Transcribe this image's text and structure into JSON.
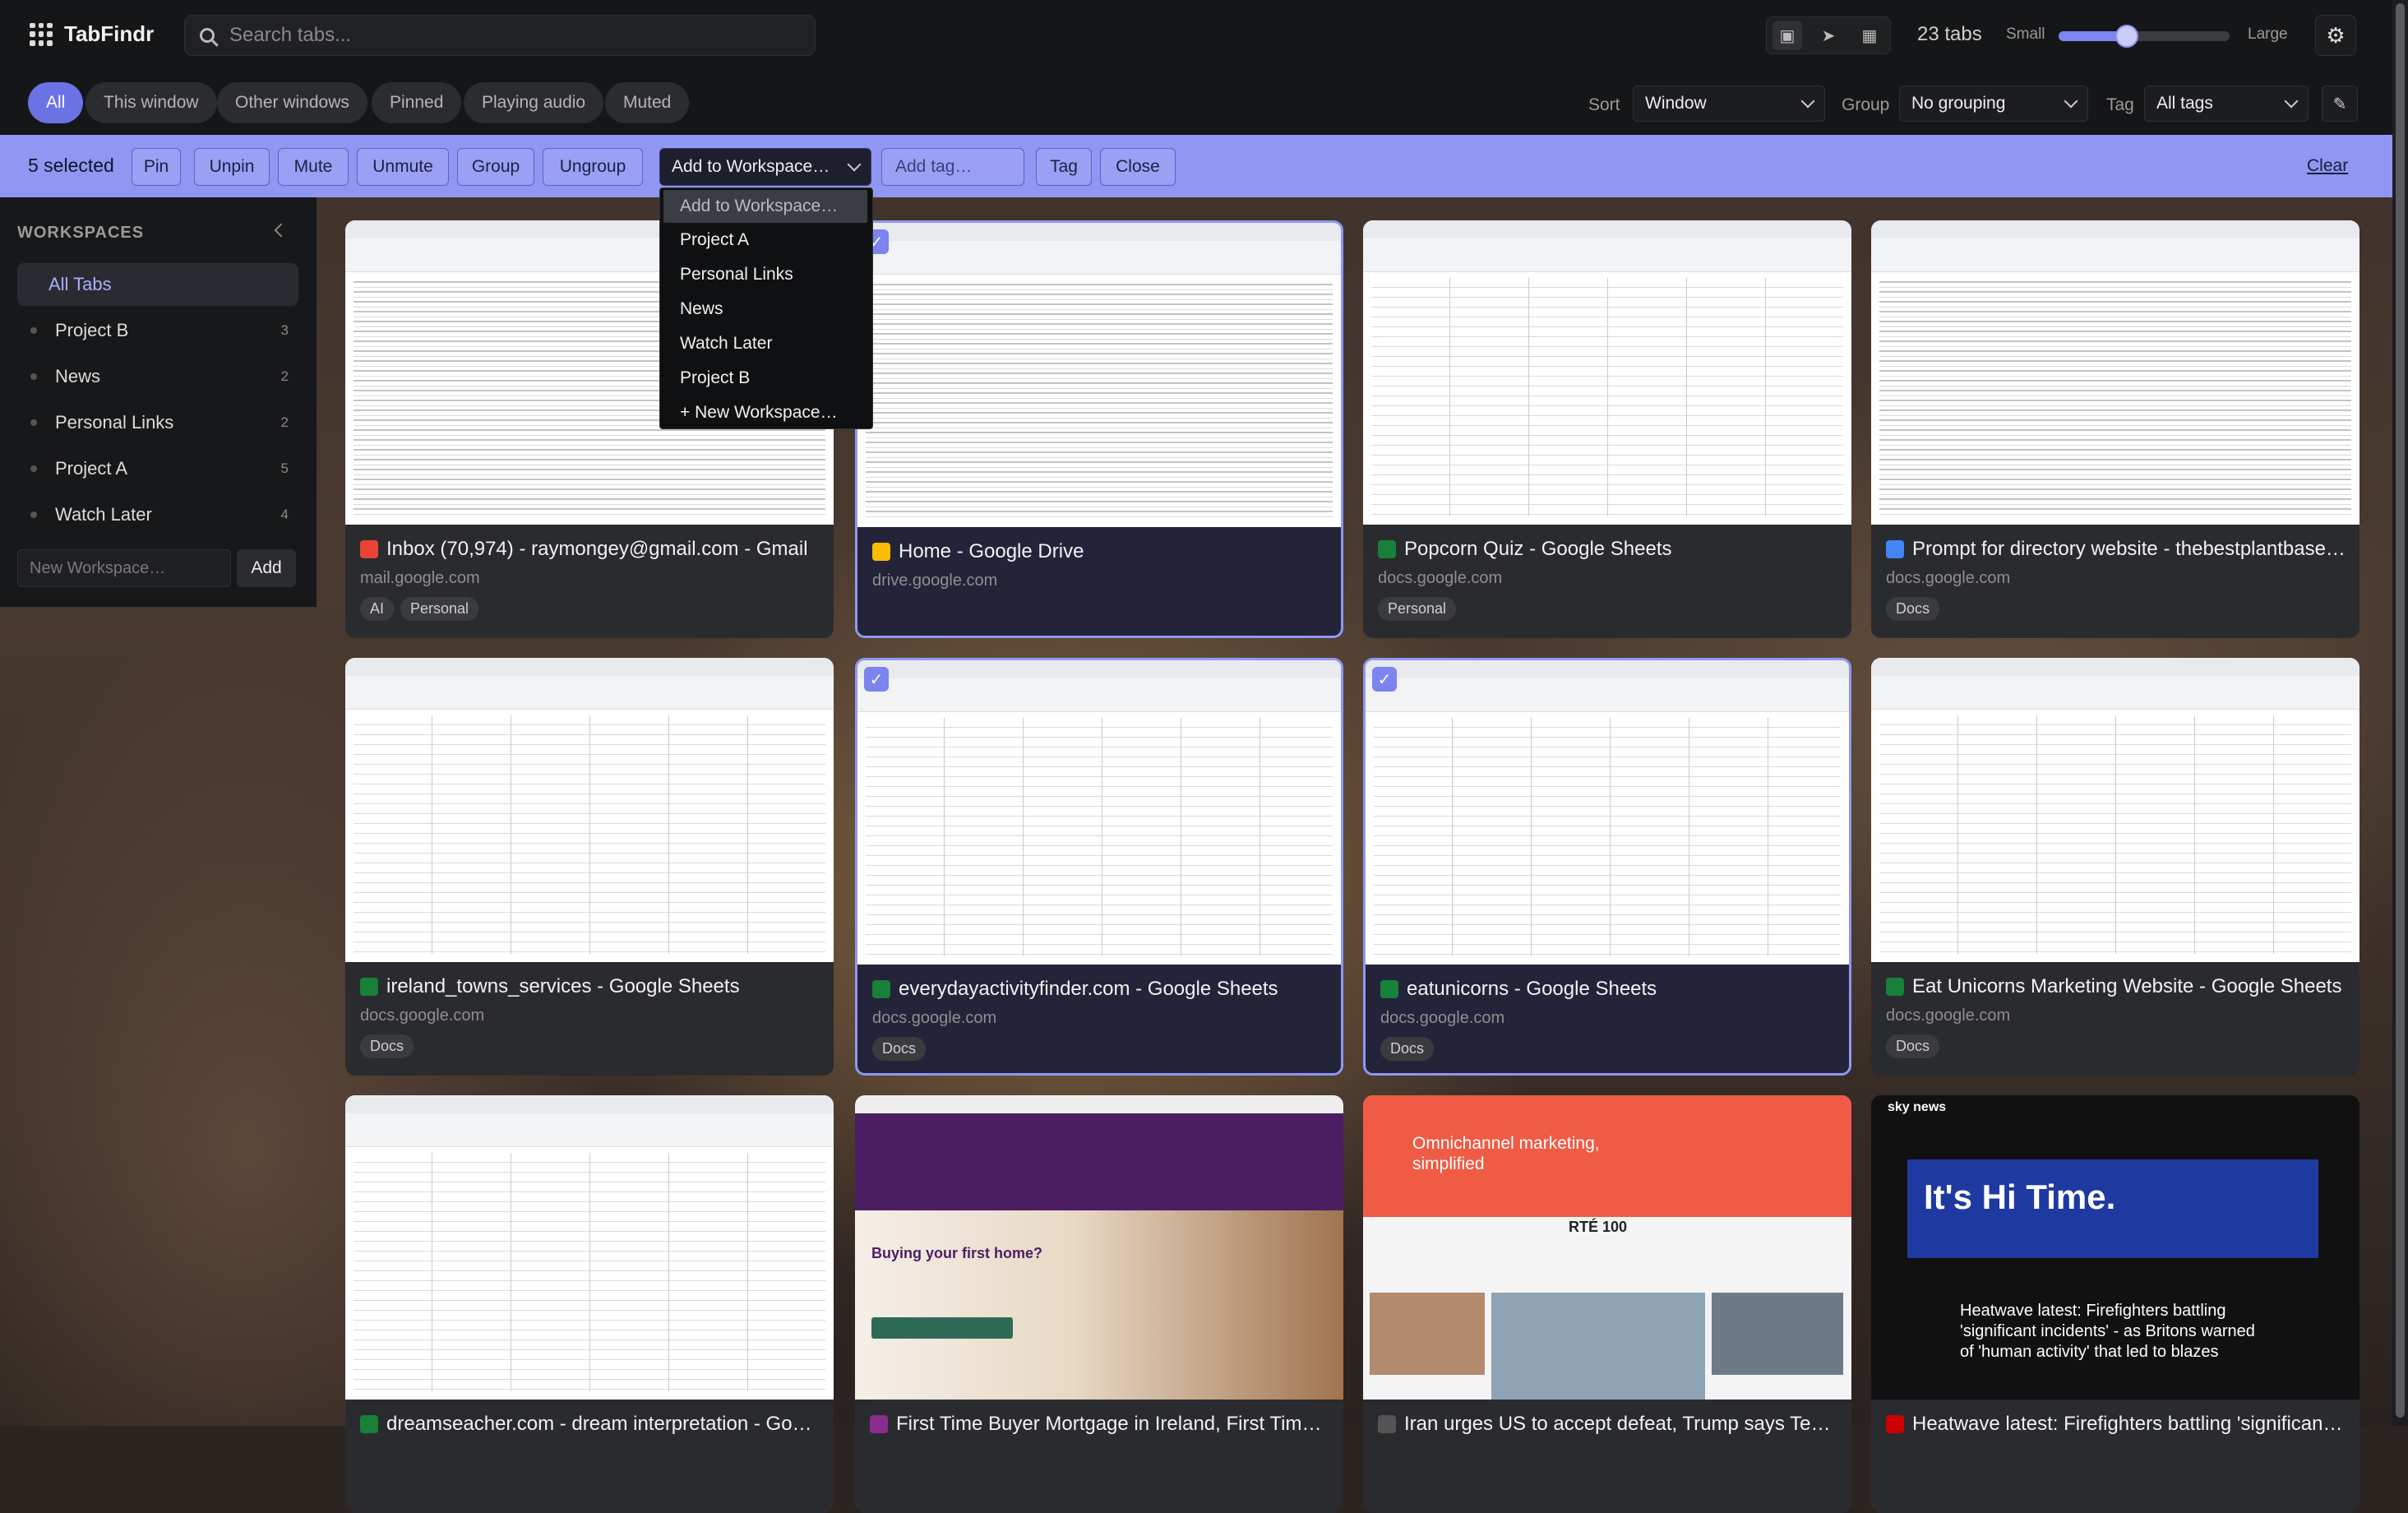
{
  "app": {
    "name": "TabFindr"
  },
  "search": {
    "placeholder": "Search tabs..."
  },
  "header": {
    "tab_count": "23 tabs",
    "size_small": "Small",
    "size_large": "Large",
    "size_value": 0.4
  },
  "filters": {
    "chips": [
      "All",
      "This window",
      "Other windows",
      "Pinned",
      "Playing audio",
      "Muted"
    ],
    "active": "All",
    "sort_label": "Sort",
    "sort_value": "Window",
    "group_label": "Group",
    "group_value": "No grouping",
    "tag_label": "Tag",
    "tag_value": "All tags"
  },
  "selection": {
    "count": "5 selected",
    "buttons": {
      "pin": "Pin",
      "unpin": "Unpin",
      "mute": "Mute",
      "unmute": "Unmute",
      "group": "Group",
      "ungroup": "Ungroup",
      "tag": "Tag",
      "close": "Close"
    },
    "workspace_select": "Add to Workspace…",
    "tag_placeholder": "Add tag…",
    "clear": "Clear"
  },
  "dropdown": {
    "items": [
      "Add to Workspace…",
      "Project A",
      "Personal Links",
      "News",
      "Watch Later",
      "Project B",
      "+ New Workspace…"
    ]
  },
  "sidebar": {
    "title": "WORKSPACES",
    "items": [
      {
        "label": "All Tabs",
        "count": ""
      },
      {
        "label": "Project B",
        "count": "3"
      },
      {
        "label": "News",
        "count": "2"
      },
      {
        "label": "Personal Links",
        "count": "2"
      },
      {
        "label": "Project A",
        "count": "5"
      },
      {
        "label": "Watch Later",
        "count": "4"
      }
    ],
    "new_placeholder": "New Workspace…",
    "add_label": "Add"
  },
  "cards": [
    {
      "title": "Inbox (70,974) - raymongey@gmail.com - Gmail",
      "domain": "mail.google.com",
      "tags": [
        "AI",
        "Personal"
      ],
      "favicon": "gmail-icon",
      "fav_color": "#ea4335",
      "selected": false
    },
    {
      "title": "Home - Google Drive",
      "domain": "drive.google.com",
      "tags": [],
      "favicon": "drive-icon",
      "fav_color": "#fbbc04",
      "selected": true
    },
    {
      "title": "Popcorn Quiz - Google Sheets",
      "domain": "docs.google.com",
      "tags": [
        "Personal"
      ],
      "favicon": "sheets-icon",
      "fav_color": "#188038",
      "selected": false
    },
    {
      "title": "Prompt for directory website - thebestplantbase…",
      "domain": "docs.google.com",
      "tags": [
        "Docs"
      ],
      "favicon": "docs-icon",
      "fav_color": "#4285f4",
      "selected": false
    },
    {
      "title": "ireland_towns_services - Google Sheets",
      "domain": "docs.google.com",
      "tags": [
        "Docs"
      ],
      "favicon": "sheets-icon",
      "fav_color": "#188038",
      "selected": false
    },
    {
      "title": "everydayactivityfinder.com - Google Sheets",
      "domain": "docs.google.com",
      "tags": [
        "Docs"
      ],
      "favicon": "sheets-icon",
      "fav_color": "#188038",
      "selected": true
    },
    {
      "title": "eatunicorns - Google Sheets",
      "domain": "docs.google.com",
      "tags": [
        "Docs"
      ],
      "favicon": "sheets-icon",
      "fav_color": "#188038",
      "selected": true
    },
    {
      "title": "Eat Unicorns Marketing Website - Google Sheets",
      "domain": "docs.google.com",
      "tags": [
        "Docs"
      ],
      "favicon": "sheets-icon",
      "fav_color": "#188038",
      "selected": false
    },
    {
      "title": "dreamseacher.com - dream interpretation - Goo…",
      "domain": "",
      "tags": [],
      "favicon": "sheets-icon",
      "fav_color": "#188038",
      "selected": false
    },
    {
      "title": "First Time Buyer Mortgage in Ireland, First Time…",
      "domain": "",
      "tags": [],
      "favicon": "aib-icon",
      "fav_color": "#8a2d8f",
      "selected": false
    },
    {
      "title": "Iran urges US to accept defeat, Trump says Tehra…",
      "domain": "",
      "tags": [],
      "favicon": "rte-icon",
      "fav_color": "#555555",
      "selected": false
    },
    {
      "title": "Heatwave latest: Firefighters battling 'significant…",
      "domain": "",
      "tags": [],
      "favicon": "sky-icon",
      "fav_color": "#cc0000",
      "selected": false
    }
  ],
  "thumb_text": {
    "aib_heading": "Buying your first home?",
    "klaviyo_heading": "Omnichannel marketing, simplified",
    "rte_brand": "RTÉ 100",
    "sky_brand": "sky news",
    "sky_ad": "It's Hi Time.",
    "sky_headline": "Heatwave latest: Firefighters battling 'significant incidents' - as Britons warned of 'human activity' that led to blazes"
  },
  "colors": {
    "accent": "#6a72e6",
    "selection_bar": "#8f97f2",
    "background": "#151618"
  }
}
